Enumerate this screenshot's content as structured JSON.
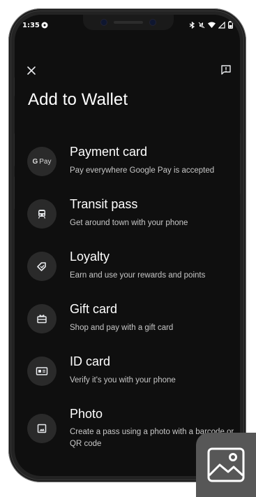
{
  "status": {
    "time": "1:35"
  },
  "header": {
    "title": "Add to Wallet"
  },
  "options": [
    {
      "icon_text_1": "G",
      "icon_text_2": "Pay",
      "title": "Payment card",
      "subtitle": "Pay everywhere Google Pay is accepted",
      "icon": "google-pay-icon"
    },
    {
      "title": "Transit pass",
      "subtitle": "Get around town with your phone",
      "icon": "train-icon"
    },
    {
      "title": "Loyalty",
      "subtitle": "Earn and use your rewards and points",
      "icon": "tag-icon"
    },
    {
      "title": "Gift card",
      "subtitle": "Shop and pay with a gift card",
      "icon": "gift-card-icon"
    },
    {
      "title": "ID card",
      "subtitle": "Verify it's you with your phone",
      "icon": "id-card-icon"
    },
    {
      "title": "Photo",
      "subtitle": "Create a pass using a photo with a barcode or QR code",
      "icon": "photo-icon"
    }
  ],
  "colors": {
    "background": "#0f0f0f",
    "icon_circle": "#2a2a2a",
    "overlay_badge": "#575757"
  }
}
